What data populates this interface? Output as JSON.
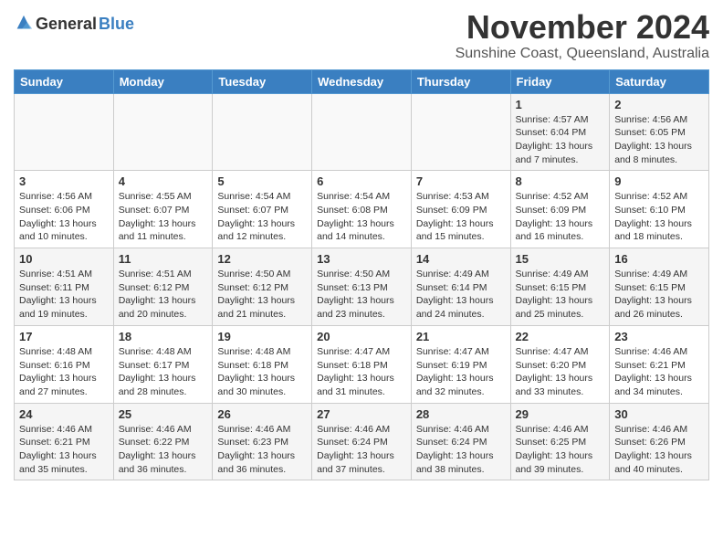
{
  "logo": {
    "general": "General",
    "blue": "Blue"
  },
  "title": "November 2024",
  "subtitle": "Sunshine Coast, Queensland, Australia",
  "days_header": [
    "Sunday",
    "Monday",
    "Tuesday",
    "Wednesday",
    "Thursday",
    "Friday",
    "Saturday"
  ],
  "weeks": [
    [
      {
        "day": "",
        "detail": ""
      },
      {
        "day": "",
        "detail": ""
      },
      {
        "day": "",
        "detail": ""
      },
      {
        "day": "",
        "detail": ""
      },
      {
        "day": "",
        "detail": ""
      },
      {
        "day": "1",
        "detail": "Sunrise: 4:57 AM\nSunset: 6:04 PM\nDaylight: 13 hours and 7 minutes."
      },
      {
        "day": "2",
        "detail": "Sunrise: 4:56 AM\nSunset: 6:05 PM\nDaylight: 13 hours and 8 minutes."
      }
    ],
    [
      {
        "day": "3",
        "detail": "Sunrise: 4:56 AM\nSunset: 6:06 PM\nDaylight: 13 hours and 10 minutes."
      },
      {
        "day": "4",
        "detail": "Sunrise: 4:55 AM\nSunset: 6:07 PM\nDaylight: 13 hours and 11 minutes."
      },
      {
        "day": "5",
        "detail": "Sunrise: 4:54 AM\nSunset: 6:07 PM\nDaylight: 13 hours and 12 minutes."
      },
      {
        "day": "6",
        "detail": "Sunrise: 4:54 AM\nSunset: 6:08 PM\nDaylight: 13 hours and 14 minutes."
      },
      {
        "day": "7",
        "detail": "Sunrise: 4:53 AM\nSunset: 6:09 PM\nDaylight: 13 hours and 15 minutes."
      },
      {
        "day": "8",
        "detail": "Sunrise: 4:52 AM\nSunset: 6:09 PM\nDaylight: 13 hours and 16 minutes."
      },
      {
        "day": "9",
        "detail": "Sunrise: 4:52 AM\nSunset: 6:10 PM\nDaylight: 13 hours and 18 minutes."
      }
    ],
    [
      {
        "day": "10",
        "detail": "Sunrise: 4:51 AM\nSunset: 6:11 PM\nDaylight: 13 hours and 19 minutes."
      },
      {
        "day": "11",
        "detail": "Sunrise: 4:51 AM\nSunset: 6:12 PM\nDaylight: 13 hours and 20 minutes."
      },
      {
        "day": "12",
        "detail": "Sunrise: 4:50 AM\nSunset: 6:12 PM\nDaylight: 13 hours and 21 minutes."
      },
      {
        "day": "13",
        "detail": "Sunrise: 4:50 AM\nSunset: 6:13 PM\nDaylight: 13 hours and 23 minutes."
      },
      {
        "day": "14",
        "detail": "Sunrise: 4:49 AM\nSunset: 6:14 PM\nDaylight: 13 hours and 24 minutes."
      },
      {
        "day": "15",
        "detail": "Sunrise: 4:49 AM\nSunset: 6:15 PM\nDaylight: 13 hours and 25 minutes."
      },
      {
        "day": "16",
        "detail": "Sunrise: 4:49 AM\nSunset: 6:15 PM\nDaylight: 13 hours and 26 minutes."
      }
    ],
    [
      {
        "day": "17",
        "detail": "Sunrise: 4:48 AM\nSunset: 6:16 PM\nDaylight: 13 hours and 27 minutes."
      },
      {
        "day": "18",
        "detail": "Sunrise: 4:48 AM\nSunset: 6:17 PM\nDaylight: 13 hours and 28 minutes."
      },
      {
        "day": "19",
        "detail": "Sunrise: 4:48 AM\nSunset: 6:18 PM\nDaylight: 13 hours and 30 minutes."
      },
      {
        "day": "20",
        "detail": "Sunrise: 4:47 AM\nSunset: 6:18 PM\nDaylight: 13 hours and 31 minutes."
      },
      {
        "day": "21",
        "detail": "Sunrise: 4:47 AM\nSunset: 6:19 PM\nDaylight: 13 hours and 32 minutes."
      },
      {
        "day": "22",
        "detail": "Sunrise: 4:47 AM\nSunset: 6:20 PM\nDaylight: 13 hours and 33 minutes."
      },
      {
        "day": "23",
        "detail": "Sunrise: 4:46 AM\nSunset: 6:21 PM\nDaylight: 13 hours and 34 minutes."
      }
    ],
    [
      {
        "day": "24",
        "detail": "Sunrise: 4:46 AM\nSunset: 6:21 PM\nDaylight: 13 hours and 35 minutes."
      },
      {
        "day": "25",
        "detail": "Sunrise: 4:46 AM\nSunset: 6:22 PM\nDaylight: 13 hours and 36 minutes."
      },
      {
        "day": "26",
        "detail": "Sunrise: 4:46 AM\nSunset: 6:23 PM\nDaylight: 13 hours and 36 minutes."
      },
      {
        "day": "27",
        "detail": "Sunrise: 4:46 AM\nSunset: 6:24 PM\nDaylight: 13 hours and 37 minutes."
      },
      {
        "day": "28",
        "detail": "Sunrise: 4:46 AM\nSunset: 6:24 PM\nDaylight: 13 hours and 38 minutes."
      },
      {
        "day": "29",
        "detail": "Sunrise: 4:46 AM\nSunset: 6:25 PM\nDaylight: 13 hours and 39 minutes."
      },
      {
        "day": "30",
        "detail": "Sunrise: 4:46 AM\nSunset: 6:26 PM\nDaylight: 13 hours and 40 minutes."
      }
    ]
  ]
}
